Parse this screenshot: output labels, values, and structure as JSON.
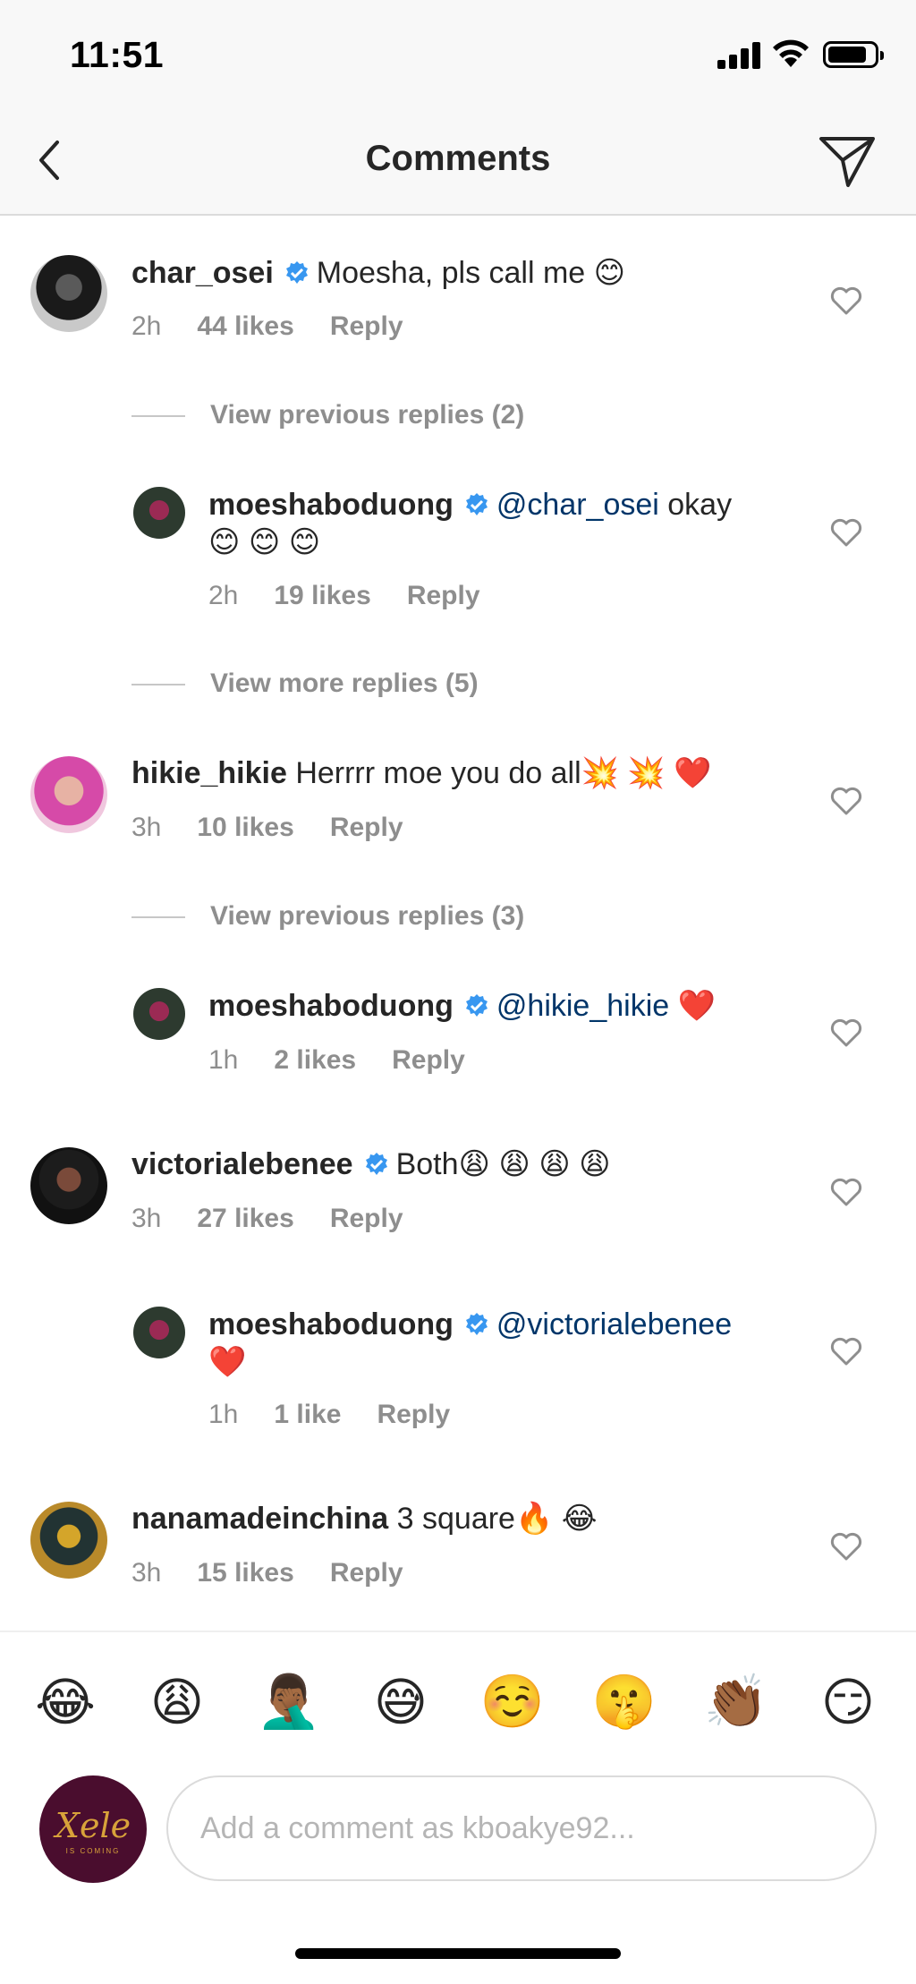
{
  "status_bar": {
    "time": "11:51"
  },
  "header": {
    "title": "Comments"
  },
  "comments": [
    {
      "user": "char_osei",
      "verified": true,
      "text": "Moesha, pls call me 😊",
      "time": "2h",
      "likes": "44 likes",
      "reply": "Reply"
    },
    {
      "view_label": "View previous replies (2)"
    },
    {
      "user": "moeshaboduong",
      "verified": true,
      "mention": "@char_osei",
      "text": " okay",
      "text2": "😊 😊 😊",
      "time": "2h",
      "likes": "19 likes",
      "reply": "Reply"
    },
    {
      "view_label": "View more replies (5)"
    },
    {
      "user": "hikie_hikie",
      "verified": false,
      "text": " Herrrr moe you do all💥 💥 ❤️",
      "time": "3h",
      "likes": "10 likes",
      "reply": "Reply"
    },
    {
      "view_label": "View previous replies (3)"
    },
    {
      "user": "moeshaboduong",
      "verified": true,
      "mention": "@hikie_hikie",
      "text": " ❤️",
      "time": "1h",
      "likes": "2 likes",
      "reply": "Reply"
    },
    {
      "user": "victorialebenee",
      "verified": true,
      "text": "Both😩 😩 😩 😩",
      "time": "3h",
      "likes": "27 likes",
      "reply": "Reply"
    },
    {
      "user": "moeshaboduong",
      "verified": true,
      "mention": "@victorialebenee",
      "text": "",
      "text2": "❤️",
      "time": "1h",
      "likes": "1 like",
      "reply": "Reply"
    },
    {
      "user": "nanamadeinchina",
      "verified": false,
      "text": " 3 square🔥 😂",
      "time": "3h",
      "likes": "15 likes",
      "reply": "Reply"
    }
  ],
  "emoji_bar": [
    "😂",
    "😩",
    "🤦🏾‍♂️",
    "😅",
    "☺️",
    "🤫",
    "👏🏾",
    "😏"
  ],
  "composer": {
    "avatar_logo": "Xele",
    "avatar_sub": "IS COMING",
    "placeholder": "Add a comment as kboakye92..."
  },
  "colors": {
    "verified": "#3897f0",
    "mention": "#003569",
    "secondary": "#8e8e8e"
  }
}
